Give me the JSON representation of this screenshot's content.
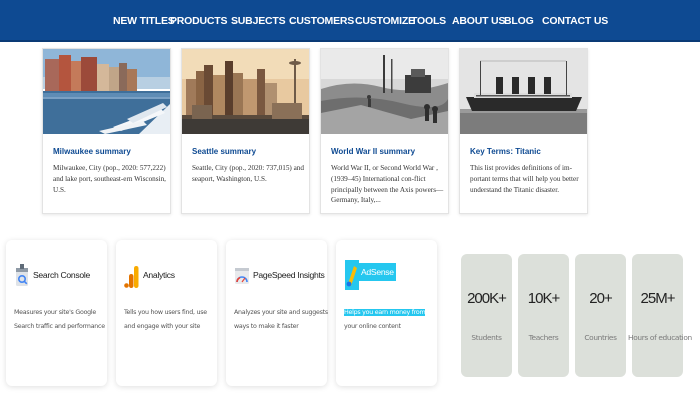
{
  "nav": {
    "items": [
      {
        "label": "NEW TITLES",
        "caret": false
      },
      {
        "label": "PRODUCTS",
        "caret": true
      },
      {
        "label": "SUBJECTS",
        "caret": true
      },
      {
        "label": "CUSTOMERS",
        "caret": true
      },
      {
        "label": "CUSTOMIZE",
        "caret": false
      },
      {
        "label": "TOOLS",
        "caret": false
      },
      {
        "label": "ABOUT US",
        "caret": false
      },
      {
        "label": "BLOG",
        "caret": false
      },
      {
        "label": "CONTACT US",
        "caret": false
      }
    ],
    "caret_glyph": "⌄",
    "background": "#0e4a92"
  },
  "cards": [
    {
      "title": "Milwaukee summary",
      "description": "Milwaukee, City (pop., 2020: 577,222) and lake port, southeast-ern Wisconsin, U.S."
    },
    {
      "title": "Seattle summary",
      "description": "Seattle, City (pop., 2020: 737,015) and seaport, Washington, U.S."
    },
    {
      "title": "World War II summary",
      "description": "World War II, or Second World War , (1939–45) International con-flict principally between the Axis powers—Germany, Italy,..."
    },
    {
      "title": "Key Terms: Titanic",
      "description": "This list provides definitions of im-portant terms that will help you better understand the Titanic disaster."
    }
  ],
  "tools": [
    {
      "name": "Search Console",
      "icon": "search-console-icon",
      "description": "Measures your site's Google Search traffic and performance"
    },
    {
      "name": "Analytics",
      "icon": "analytics-icon",
      "description": "Tells you how users find, use and engage with your site"
    },
    {
      "name": "PageSpeed Insights",
      "icon": "pagespeed-icon",
      "description": "Analyzes your site and suggests ways to make it faster"
    },
    {
      "name": "AdSense",
      "icon": "adsense-icon",
      "description_highlight": "Helps you earn money from",
      "description_rest": "your online content"
    }
  ],
  "stats": [
    {
      "value": "200K+",
      "label": "Students"
    },
    {
      "value": "10K+",
      "label": "Teachers"
    },
    {
      "value": "20+",
      "label": "Countries"
    },
    {
      "value": "25M+",
      "label": "Hours of education"
    }
  ],
  "colors": {
    "link_blue": "#0e4a92",
    "highlight_cyan": "#25c7ef",
    "stat_bg": "#dce0da"
  }
}
